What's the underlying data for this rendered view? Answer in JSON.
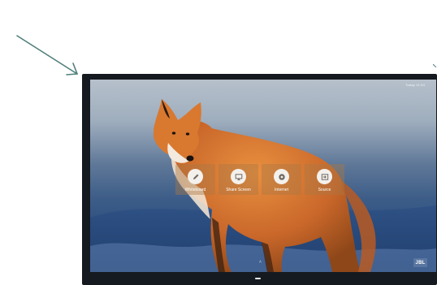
{
  "screen": {
    "corner_text": "Today 11:04",
    "bottom_glyph": "˄",
    "brand": "JBL"
  },
  "tiles": [
    {
      "label": "Whiteboard",
      "icon": "pencil-icon"
    },
    {
      "label": "Share Screen",
      "icon": "cast-icon"
    },
    {
      "label": "Internet",
      "icon": "globe-icon"
    },
    {
      "label": "Source",
      "icon": "input-source-icon"
    }
  ],
  "colors": {
    "callout_arrow": "#4f7f7a",
    "bezel": "#151a20",
    "tile_background": "rgba(170,120,70,0.42)",
    "icon_circle": "#f4f1ec",
    "icon_glyph": "#6f6a66"
  }
}
